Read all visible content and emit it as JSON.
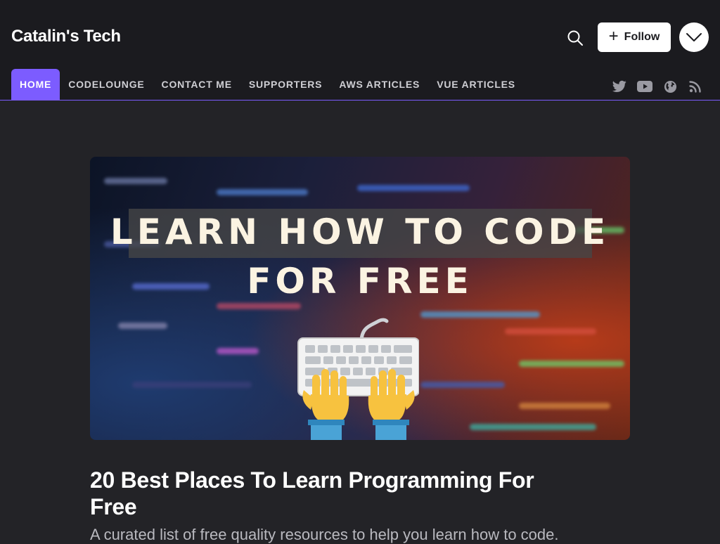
{
  "header": {
    "brand": "Catalin's Tech",
    "follow_label": "Follow"
  },
  "nav": {
    "items": [
      {
        "label": "HOME",
        "active": true
      },
      {
        "label": "CODELOUNGE"
      },
      {
        "label": "CONTACT ME"
      },
      {
        "label": "SUPPORTERS"
      },
      {
        "label": "AWS ARTICLES"
      },
      {
        "label": "VUE ARTICLES"
      }
    ]
  },
  "socials": [
    "twitter-icon",
    "youtube-icon",
    "globe-icon",
    "rss-icon"
  ],
  "featured": {
    "cover_line1": "LEARN HOW TO CODE",
    "cover_line2": "FOR FREE",
    "title": "20 Best Places To Learn Programming For Free",
    "subtitle": "A curated list of free quality resources to help you learn how to code."
  },
  "colors": {
    "accent": "#7c5cff",
    "header_bg": "#1b1b1f",
    "page_bg": "#232327"
  }
}
